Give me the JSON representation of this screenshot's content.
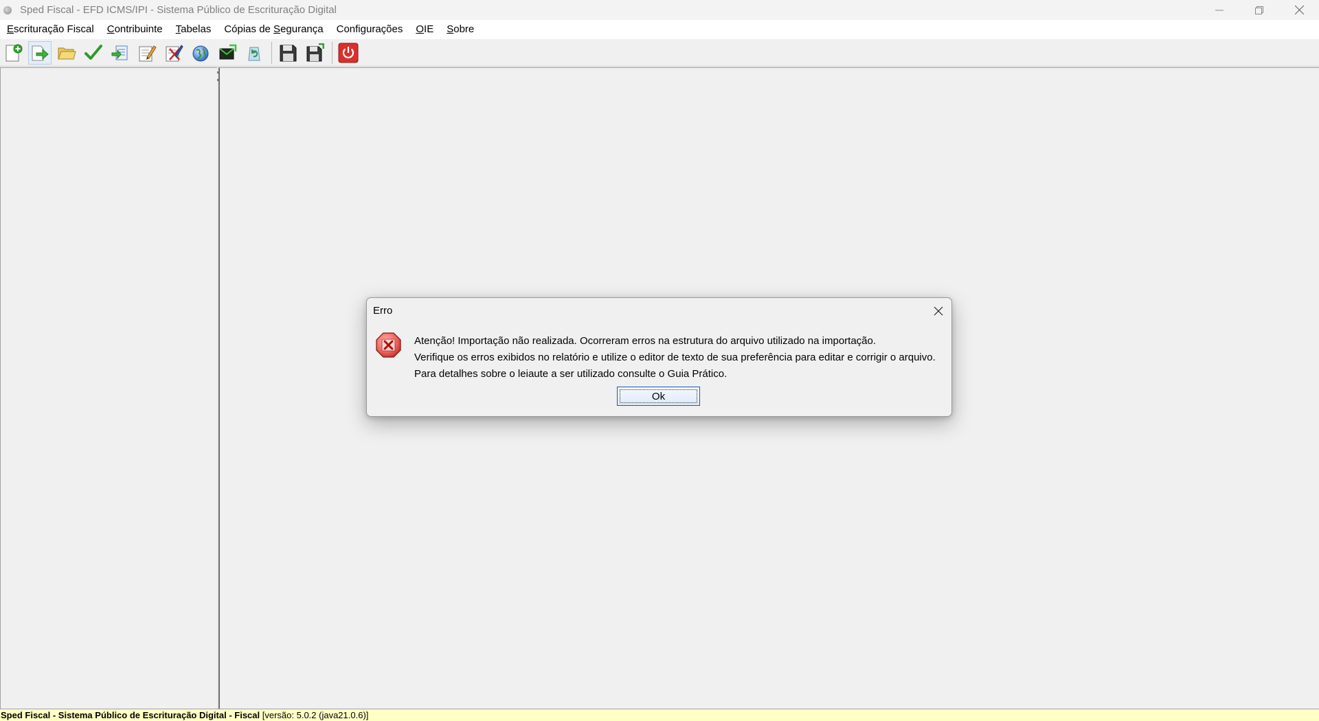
{
  "window": {
    "title": "Sped Fiscal - EFD ICMS/IPI - Sistema Público de Escrituração Digital"
  },
  "menu": {
    "items": [
      {
        "mnemonic": "E",
        "rest": "scrituração Fiscal"
      },
      {
        "mnemonic": "C",
        "rest": "ontribuinte"
      },
      {
        "mnemonic": "T",
        "rest": "abelas"
      },
      {
        "pre": "Cópias de ",
        "mnemonic": "S",
        "rest": "egurança"
      },
      {
        "mnemonic": "",
        "rest": "Configurações"
      },
      {
        "mnemonic": "O",
        "rest": "IE"
      },
      {
        "mnemonic": "S",
        "rest": "obre"
      }
    ]
  },
  "toolbar": {
    "icons": [
      "new-document-icon",
      "import-arrow-icon",
      "open-folder-icon",
      "validate-check-icon",
      "export-icon",
      "edit-document-icon",
      "sign-document-icon",
      "globe-icon",
      "transmit-icon",
      "recycle-icon",
      "save-icon",
      "save-as-icon",
      "power-icon"
    ]
  },
  "dialog": {
    "title": "Erro",
    "lines": [
      "Atenção! Importação não realizada. Ocorreram erros na estrutura do arquivo utilizado na importação.",
      "Verifique os erros exibidos no relatório e utilize o editor de texto de sua preferência para editar e corrigir o arquivo.",
      "Para detalhes sobre o leiaute a ser utilizado consulte o Guia Prático."
    ],
    "ok_label": "Ok"
  },
  "status": {
    "app_name": "Sped Fiscal - Sistema Público de Escrituração Digital - Fiscal",
    "version": "[versão: 5.0.2 (java21.0.6)]"
  },
  "colors": {
    "status_bg": "#ffffc6",
    "error_red": "#d9302c",
    "focus_blue": "#1a57b7"
  }
}
